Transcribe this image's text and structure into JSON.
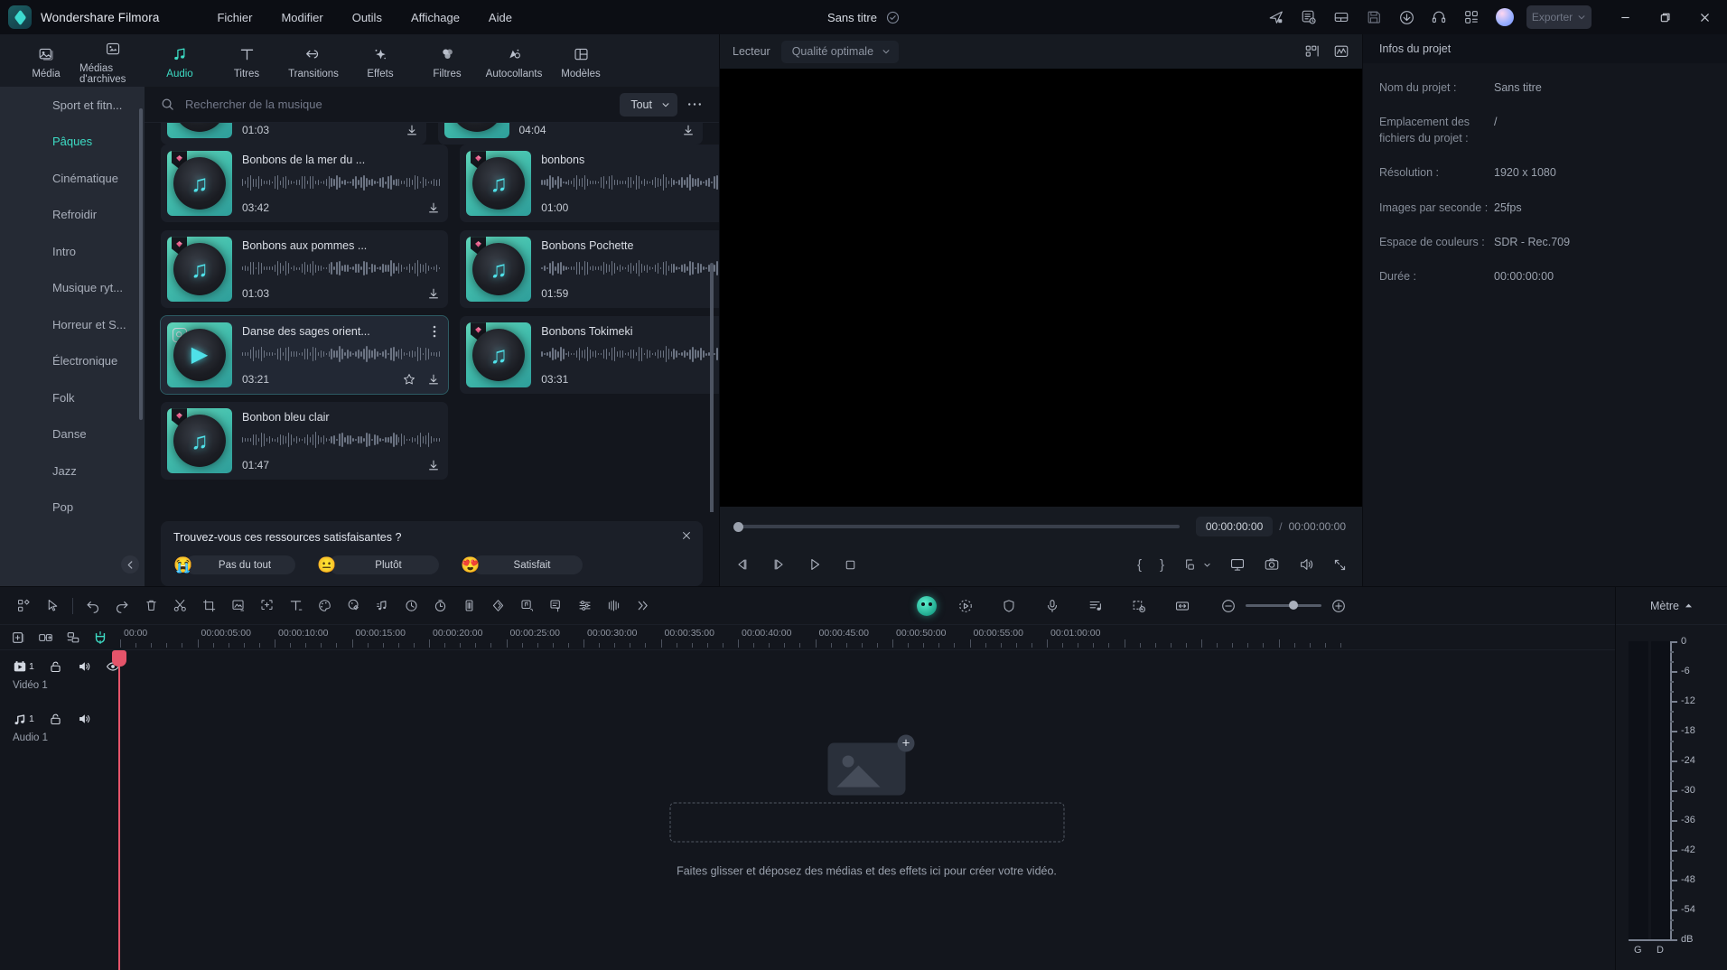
{
  "titlebar": {
    "app_name": "Wondershare Filmora",
    "menus": [
      "Fichier",
      "Modifier",
      "Outils",
      "Affichage",
      "Aide"
    ],
    "doc_title": "Sans titre",
    "icons": [
      "send-icon",
      "task-list-icon",
      "layout-icon",
      "save-icon",
      "cloud-download-icon",
      "headset-icon",
      "apps-grid-icon"
    ],
    "export_label": "Exporter",
    "window_controls": [
      "minimize-icon",
      "restore-icon",
      "close-icon"
    ]
  },
  "tabs": [
    {
      "label": "Média",
      "icon": "media-icon",
      "active": false
    },
    {
      "label": "Médias d'archives",
      "icon": "stock-media-icon",
      "active": false
    },
    {
      "label": "Audio",
      "icon": "audio-note-icon",
      "active": true
    },
    {
      "label": "Titres",
      "icon": "titles-icon",
      "active": false
    },
    {
      "label": "Transitions",
      "icon": "transitions-icon",
      "active": false
    },
    {
      "label": "Effets",
      "icon": "effects-icon",
      "active": false
    },
    {
      "label": "Filtres",
      "icon": "filters-icon",
      "active": false
    },
    {
      "label": "Autocollants",
      "icon": "stickers-icon",
      "active": false
    },
    {
      "label": "Modèles",
      "icon": "templates-icon",
      "active": false
    }
  ],
  "categories": [
    {
      "label": "Sport et fitn...",
      "active": false
    },
    {
      "label": "Pâques",
      "active": true
    },
    {
      "label": "Cinématique",
      "active": false
    },
    {
      "label": "Refroidir",
      "active": false
    },
    {
      "label": "Intro",
      "active": false
    },
    {
      "label": "Musique ryt...",
      "active": false
    },
    {
      "label": "Horreur et S...",
      "active": false
    },
    {
      "label": "Électronique",
      "active": false
    },
    {
      "label": "Folk",
      "active": false
    },
    {
      "label": "Danse",
      "active": false
    },
    {
      "label": "Jazz",
      "active": false
    },
    {
      "label": "Pop",
      "active": false
    }
  ],
  "search": {
    "placeholder": "Rechercher de la musique",
    "value": "",
    "filter_label": "Tout",
    "more_label": "•••"
  },
  "music_partial_row": [
    {
      "duration": "01:03"
    },
    {
      "duration": "04:04"
    }
  ],
  "music_items": [
    {
      "title": "Bonbons de la mer du ...",
      "duration": "03:42",
      "badge": "gem",
      "favorite": false,
      "selected": false
    },
    {
      "title": "bonbons",
      "duration": "01:00",
      "badge": "gem",
      "favorite": false,
      "selected": false
    },
    {
      "title": "Bonbons aux pommes ...",
      "duration": "01:03",
      "badge": "gem",
      "favorite": false,
      "selected": false
    },
    {
      "title": "Bonbons Pochette",
      "duration": "01:59",
      "badge": "gem",
      "favorite": false,
      "selected": false
    },
    {
      "title": "Danse des sages orient...",
      "duration": "03:21",
      "badge": "lens",
      "favorite": true,
      "selected": true
    },
    {
      "title": "Bonbons Tokimeki",
      "duration": "03:31",
      "badge": "gem",
      "favorite": false,
      "selected": false
    },
    {
      "title": "Bonbon bleu clair",
      "duration": "01:47",
      "badge": "gem",
      "favorite": false,
      "selected": false
    }
  ],
  "survey": {
    "question": "Trouvez-vous ces ressources satisfaisantes ?",
    "options": [
      {
        "emoji": "😭",
        "label": "Pas du tout"
      },
      {
        "emoji": "😐",
        "label": "Plutôt"
      },
      {
        "emoji": "😍",
        "label": "Satisfait"
      }
    ],
    "close_label": "✕"
  },
  "player": {
    "label": "Lecteur",
    "quality": "Qualité optimale",
    "current_time": "00:00:00:00",
    "total_time": "00:00:00:00",
    "separator": "/",
    "mark_in": "{",
    "mark_out": "}"
  },
  "project_info": {
    "header": "Infos du projet",
    "rows": [
      {
        "key": "Nom du projet :",
        "value": "Sans titre"
      },
      {
        "key": "Emplacement des fichiers du projet :",
        "value": "/"
      },
      {
        "key": "Résolution :",
        "value": "1920 x 1080"
      },
      {
        "key": "Images par seconde :",
        "value": "25fps"
      },
      {
        "key": "Espace de couleurs :",
        "value": "SDR - Rec.709"
      },
      {
        "key": "Durée :",
        "value": "00:00:00:00"
      }
    ]
  },
  "timeline": {
    "ruler_labels": [
      "00:00",
      "00:00:05:00",
      "00:00:10:00",
      "00:00:15:00",
      "00:00:20:00",
      "00:00:25:00",
      "00:00:30:00",
      "00:00:35:00",
      "00:00:40:00",
      "00:00:45:00",
      "00:00:50:00",
      "00:00:55:00",
      "00:01:00:00"
    ],
    "tracks": [
      {
        "name": "Vidéo 1",
        "index": "1",
        "type": "video"
      },
      {
        "name": "Audio 1",
        "index": "1",
        "type": "audio"
      }
    ],
    "dropzone_text": "Faites glisser et déposez des médias et des effets ici pour créer votre vidéo."
  },
  "meter": {
    "title": "Mètre",
    "labels": [
      "0",
      "-6",
      "-12",
      "-18",
      "-24",
      "-30",
      "-36",
      "-42",
      "-48",
      "-54"
    ],
    "unit": "dB",
    "channels": [
      "G",
      "D"
    ]
  },
  "colors": {
    "accent": "#3ddbc4",
    "playhead": "#e5546a",
    "panel_bg": "#13161d",
    "titlebar_bg": "#0c0e14"
  }
}
